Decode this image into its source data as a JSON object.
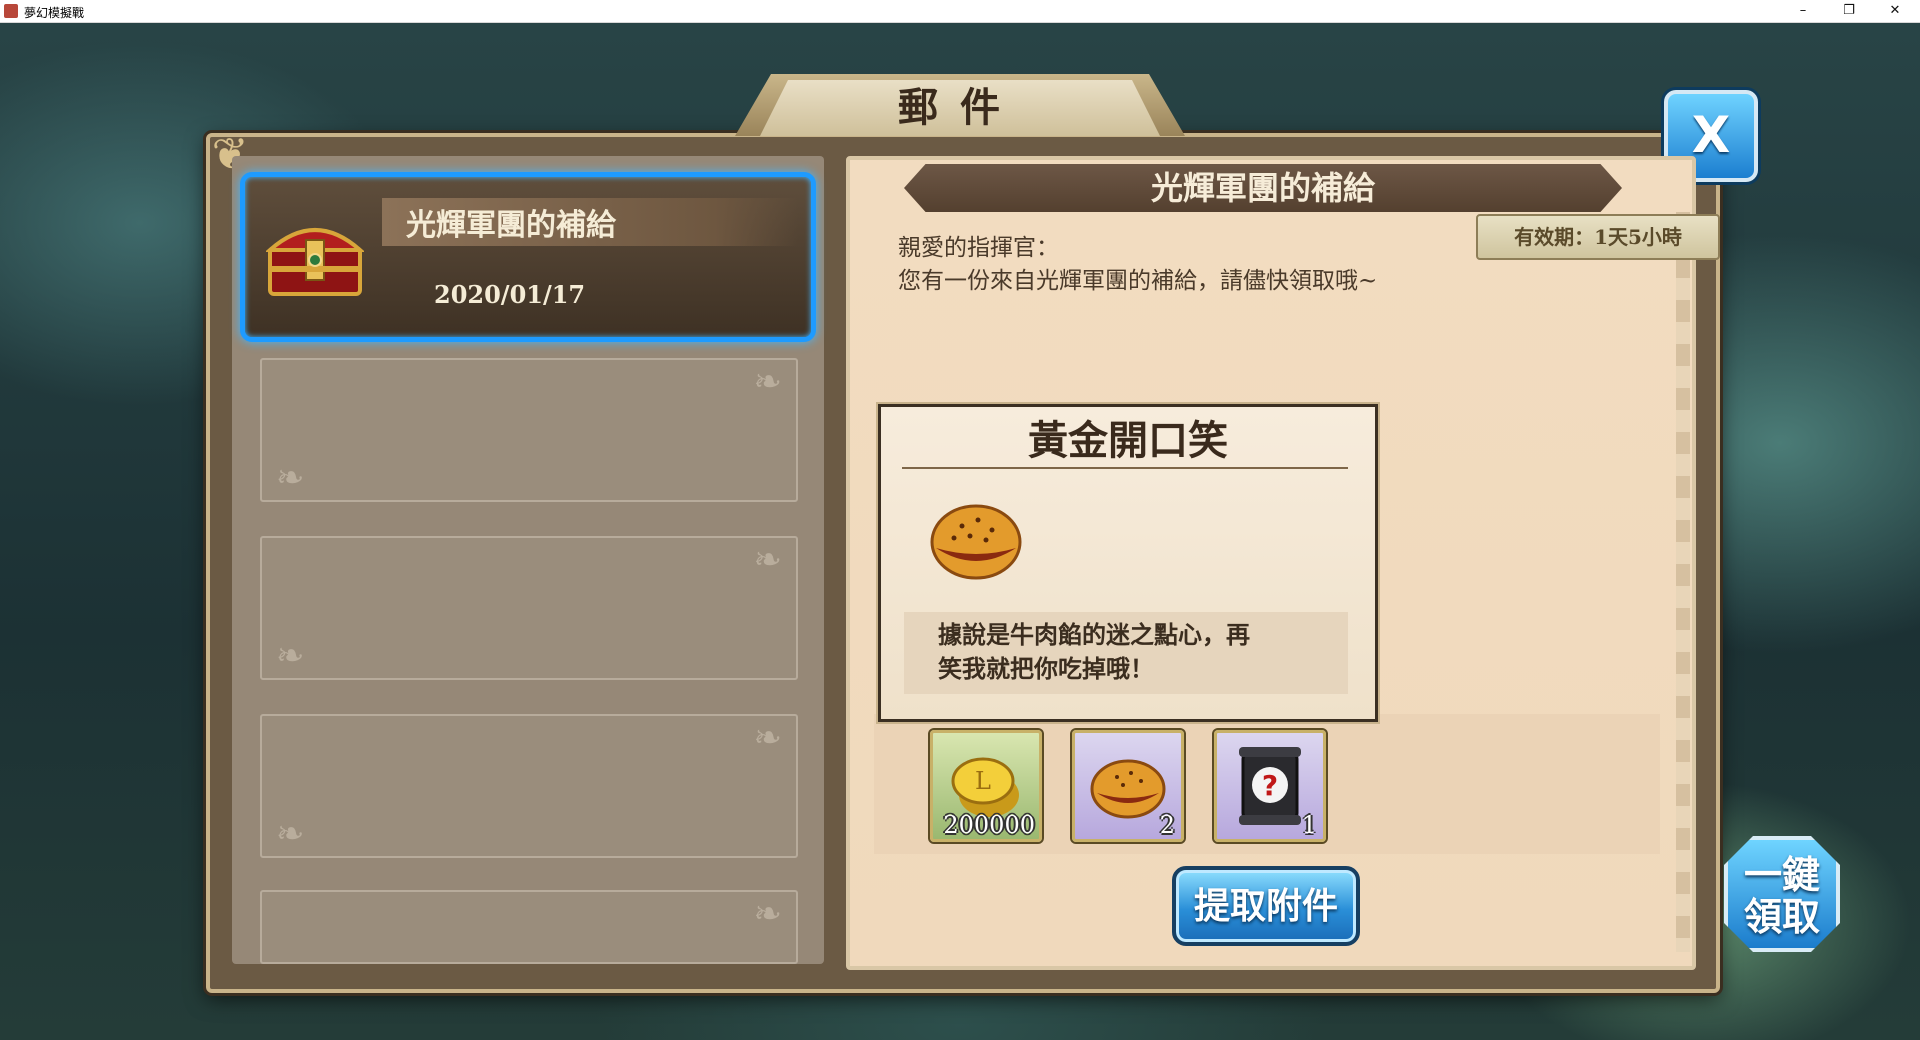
{
  "window": {
    "title": "夢幻模擬戰",
    "min_icon": "minimize-icon",
    "max_icon": "restore-icon",
    "close_icon": "close-icon"
  },
  "panel_title": "郵件",
  "close_button": {
    "label": "X"
  },
  "mail_list": [
    {
      "title": "光輝軍團的補給",
      "date": "2020/01/17",
      "icon": "treasure-chest-icon",
      "selected": true
    }
  ],
  "detail": {
    "header": "光輝軍團的補給",
    "validity": "有效期：1天5小時",
    "greeting_line1": "親愛的指揮官：",
    "greeting_line2": "您有一份來自光輝軍團的補給，請儘快領取哦~"
  },
  "item_tooltip": {
    "name": "黃金開口笑",
    "icon": "golden-pastry-icon",
    "description_line1": "據說是牛肉餡的迷之點心，再",
    "description_line2": "笑我就把你吃掉哦！"
  },
  "attachments": [
    {
      "icon": "gold-coin-icon",
      "quantity": "200000"
    },
    {
      "icon": "golden-pastry-icon",
      "quantity": "2"
    },
    {
      "icon": "mystery-scroll-icon",
      "quantity": "1"
    }
  ],
  "buttons": {
    "claim_attachment": "提取附件",
    "claim_all_line1": "一鍵",
    "claim_all_line2": "領取"
  },
  "colors": {
    "selection_glow": "#1e9bff",
    "button_blue": "#2a8fd8",
    "parchment": "#f2dcc0"
  }
}
